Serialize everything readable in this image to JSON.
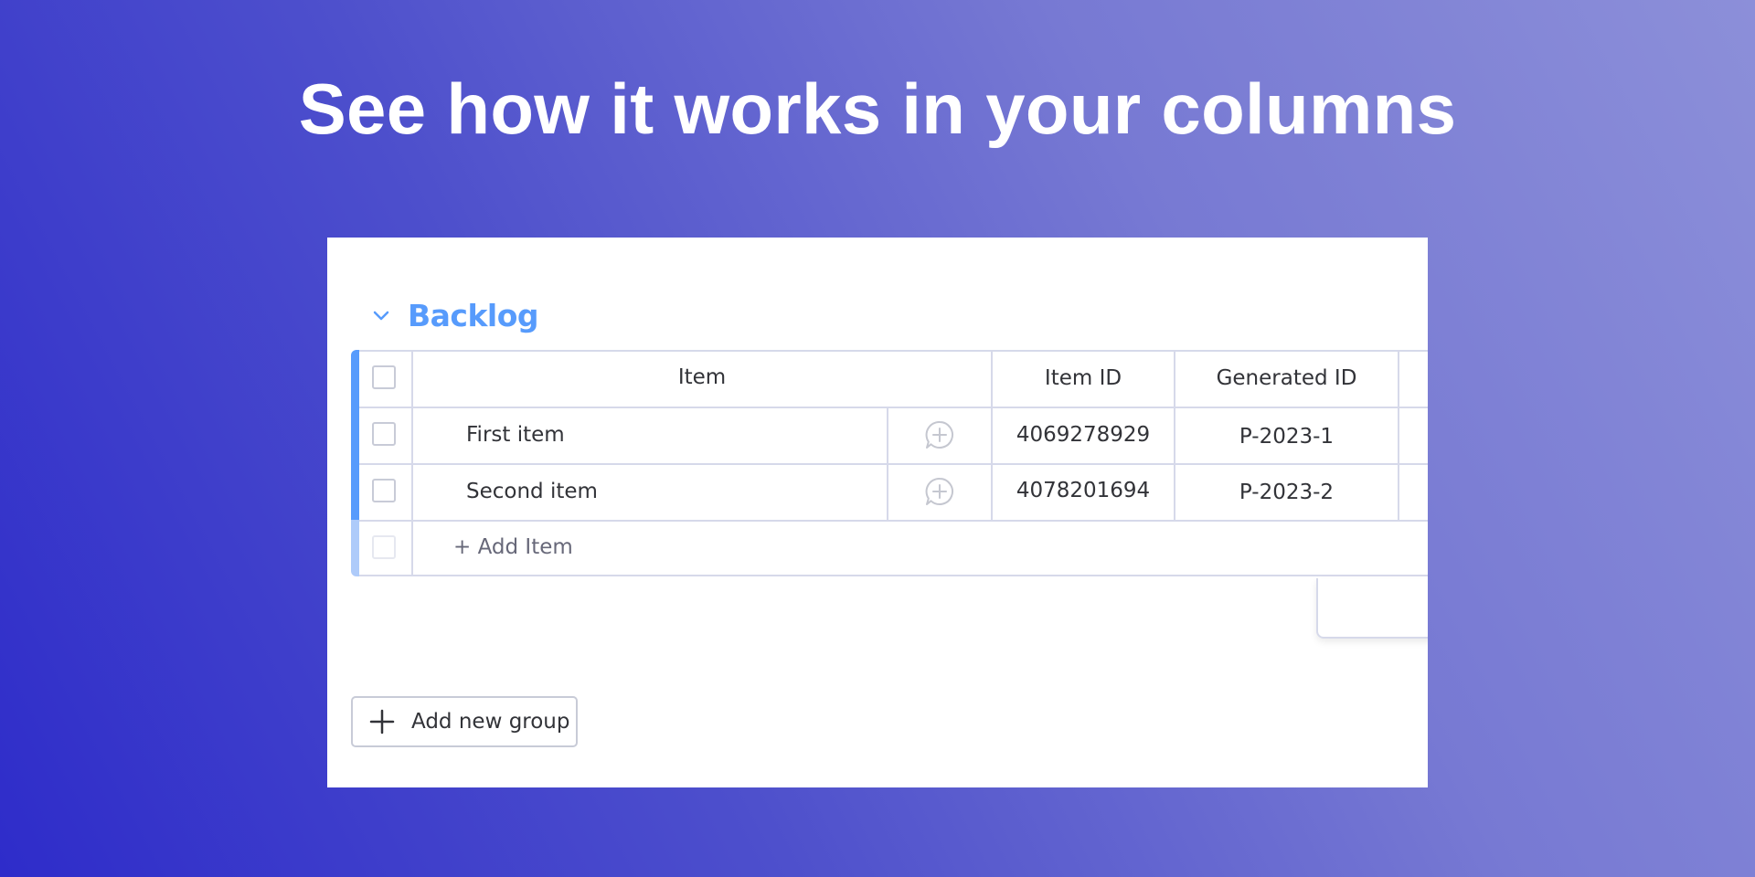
{
  "headline": "See how it works in your columns",
  "group": {
    "title": "Backlog",
    "color": "#579bfc"
  },
  "table": {
    "headers": {
      "item": "Item",
      "item_id": "Item ID",
      "generated_id": "Generated ID"
    },
    "rows": [
      {
        "name": "First item",
        "item_id": "4069278929",
        "generated_id": "P-2023-1"
      },
      {
        "name": "Second item",
        "item_id": "4078201694",
        "generated_id": "P-2023-2"
      }
    ],
    "add_item_label": "+ Add Item"
  },
  "add_group_label": "Add new group",
  "icons": {
    "collapse": "chevron-down-icon",
    "update": "add-update-icon",
    "add_group": "plus-icon"
  }
}
